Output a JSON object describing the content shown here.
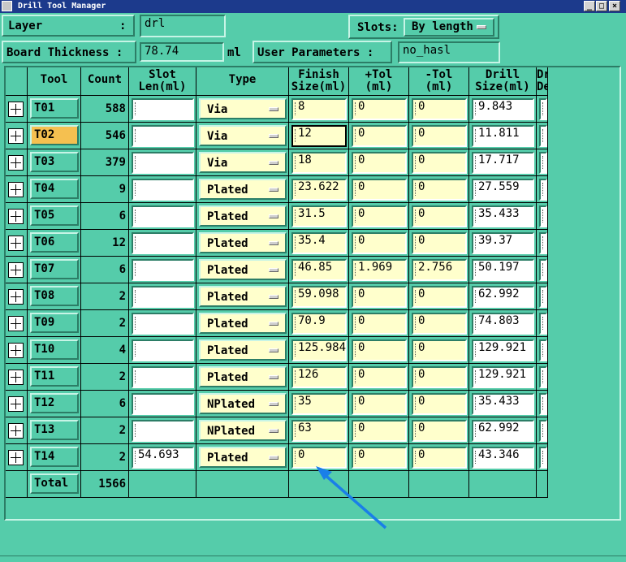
{
  "window": {
    "title": "Drill Tool Manager"
  },
  "header": {
    "layer_label": "Layer",
    "layer_colon": ":",
    "layer_value": "drl",
    "slots_label": "Slots:",
    "slots_value": "By length",
    "thickness_label": "Board Thickness :",
    "thickness_value": "78.74",
    "thickness_unit": "ml",
    "user_params_label": "User Parameters :",
    "user_params_value": "no_hasl"
  },
  "table": {
    "columns": [
      "Tool",
      "Count",
      "Slot\nLen(ml)",
      "Type",
      "Finish\nSize(ml)",
      "+Tol\n(ml)",
      "-Tol\n(ml)",
      "Drill\nSize(ml)",
      "Drill\nDes"
    ],
    "rows": [
      {
        "tool": "T01",
        "count": "588",
        "slot": "",
        "type": "Via",
        "finish": "8",
        "ptol": "0",
        "ntol": "0",
        "drill": "9.843",
        "des": ""
      },
      {
        "tool": "T02",
        "count": "546",
        "slot": "",
        "type": "Via",
        "finish": "12",
        "ptol": "0",
        "ntol": "0",
        "drill": "11.811",
        "des": ""
      },
      {
        "tool": "T03",
        "count": "379",
        "slot": "",
        "type": "Via",
        "finish": "18",
        "ptol": "0",
        "ntol": "0",
        "drill": "17.717",
        "des": ""
      },
      {
        "tool": "T04",
        "count": "9",
        "slot": "",
        "type": "Plated",
        "finish": "23.622",
        "ptol": "0",
        "ntol": "0",
        "drill": "27.559",
        "des": ""
      },
      {
        "tool": "T05",
        "count": "6",
        "slot": "",
        "type": "Plated",
        "finish": "31.5",
        "ptol": "0",
        "ntol": "0",
        "drill": "35.433",
        "des": ""
      },
      {
        "tool": "T06",
        "count": "12",
        "slot": "",
        "type": "Plated",
        "finish": "35.4",
        "ptol": "0",
        "ntol": "0",
        "drill": "39.37",
        "des": ""
      },
      {
        "tool": "T07",
        "count": "6",
        "slot": "",
        "type": "Plated",
        "finish": "46.85",
        "ptol": "1.969",
        "ntol": "2.756",
        "drill": "50.197",
        "des": ""
      },
      {
        "tool": "T08",
        "count": "2",
        "slot": "",
        "type": "Plated",
        "finish": "59.098",
        "ptol": "0",
        "ntol": "0",
        "drill": "62.992",
        "des": ""
      },
      {
        "tool": "T09",
        "count": "2",
        "slot": "",
        "type": "Plated",
        "finish": "70.9",
        "ptol": "0",
        "ntol": "0",
        "drill": "74.803",
        "des": ""
      },
      {
        "tool": "T10",
        "count": "4",
        "slot": "",
        "type": "Plated",
        "finish": "125.984",
        "ptol": "0",
        "ntol": "0",
        "drill": "129.921",
        "des": ""
      },
      {
        "tool": "T11",
        "count": "2",
        "slot": "",
        "type": "Plated",
        "finish": "126",
        "ptol": "0",
        "ntol": "0",
        "drill": "129.921",
        "des": ""
      },
      {
        "tool": "T12",
        "count": "6",
        "slot": "",
        "type": "NPlated",
        "finish": "35",
        "ptol": "0",
        "ntol": "0",
        "drill": "35.433",
        "des": ""
      },
      {
        "tool": "T13",
        "count": "2",
        "slot": "",
        "type": "NPlated",
        "finish": "63",
        "ptol": "0",
        "ntol": "0",
        "drill": "62.992",
        "des": ""
      },
      {
        "tool": "T14",
        "count": "2",
        "slot": "54.693",
        "type": "Plated",
        "finish": "0",
        "ptol": "0",
        "ntol": "0",
        "drill": "43.346",
        "des": ""
      }
    ],
    "total_label": "Total",
    "total_count": "1566"
  },
  "colors": {
    "background": "#55ccaa",
    "selected_tool": "#f5c050",
    "combo": "#ffffcc",
    "annotation_arrow": "#1a7fe8",
    "titlebar": "#1c3a8c"
  }
}
